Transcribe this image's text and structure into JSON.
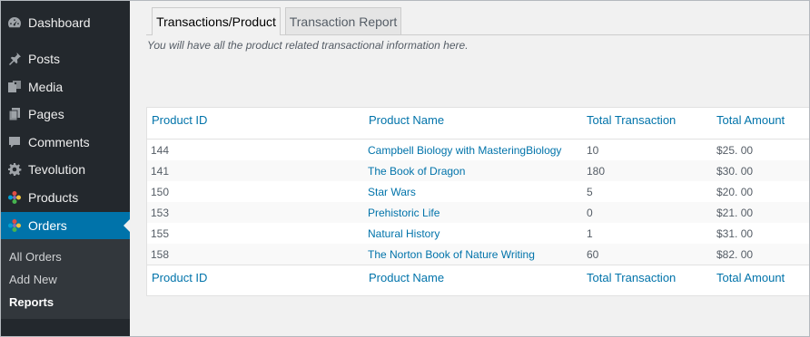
{
  "sidebar": {
    "items": [
      {
        "label": "Dashboard"
      },
      {
        "label": "Posts"
      },
      {
        "label": "Media"
      },
      {
        "label": "Pages"
      },
      {
        "label": "Comments"
      },
      {
        "label": "Tevolution"
      },
      {
        "label": "Products"
      },
      {
        "label": "Orders",
        "active": true
      }
    ],
    "submenu": [
      {
        "label": "All Orders"
      },
      {
        "label": "Add New"
      },
      {
        "label": "Reports",
        "current": true
      }
    ]
  },
  "tabs": [
    {
      "label": "Transactions/Product",
      "active": true
    },
    {
      "label": "Transaction Report",
      "active": false
    }
  ],
  "description": "You will have all the product related transactional information here.",
  "table": {
    "columns": [
      "Product ID",
      "Product Name",
      "Total Transaction",
      "Total Amount"
    ],
    "rows": [
      {
        "id": "144",
        "name": "Campbell Biology with MasteringBiology",
        "transactions": "10",
        "amount": "$25. 00"
      },
      {
        "id": "141",
        "name": "The Book of Dragon",
        "transactions": "180",
        "amount": "$30. 00"
      },
      {
        "id": "150",
        "name": "Star Wars",
        "transactions": "5",
        "amount": "$20. 00"
      },
      {
        "id": "153",
        "name": "Prehistoric Life",
        "transactions": "0",
        "amount": "$21. 00"
      },
      {
        "id": "155",
        "name": "Natural History",
        "transactions": "1",
        "amount": "$31. 00"
      },
      {
        "id": "158",
        "name": "The Norton Book of Nature Writing",
        "transactions": "60",
        "amount": "$82. 00"
      }
    ]
  },
  "colors": {
    "sidebar_bg": "#23282d",
    "submenu_bg": "#32373c",
    "accent": "#0073aa",
    "page_bg": "#f1f1f1"
  }
}
